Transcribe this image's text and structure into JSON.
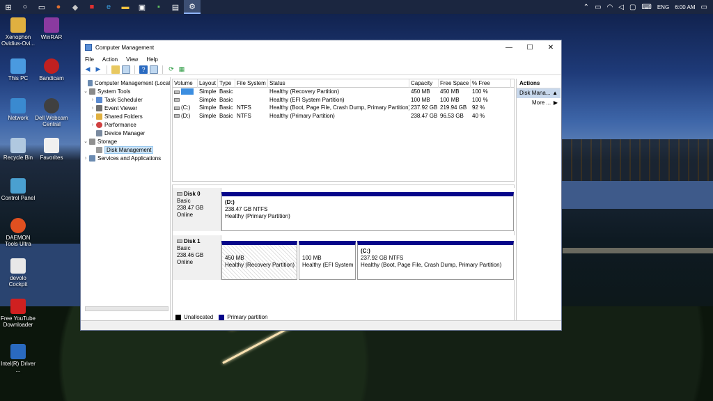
{
  "taskbar": {
    "language": "ENG",
    "time": "6:00 AM"
  },
  "desktop_icons": [
    {
      "label": "Xenophon Ovidius-Ovi..."
    },
    {
      "label": "WinRAR"
    },
    {
      "label": "This PC"
    },
    {
      "label": "Bandicam"
    },
    {
      "label": "Network"
    },
    {
      "label": "Dell Webcam Central"
    },
    {
      "label": "Recycle Bin"
    },
    {
      "label": "Favorites"
    },
    {
      "label": "Control Panel"
    },
    {
      "label": "DAEMON Tools Ultra"
    },
    {
      "label": "devolo Cockpit"
    },
    {
      "label": "Free YouTube Downloader"
    },
    {
      "label": "Intel(R) Driver ..."
    }
  ],
  "window": {
    "title": "Computer Management",
    "menu": [
      "File",
      "Action",
      "View",
      "Help"
    ]
  },
  "tree": {
    "root": "Computer Management (Local",
    "system_tools": "System Tools",
    "task_scheduler": "Task Scheduler",
    "event_viewer": "Event Viewer",
    "shared_folders": "Shared Folders",
    "performance": "Performance",
    "device_manager": "Device Manager",
    "storage": "Storage",
    "disk_management": "Disk Management",
    "services": "Services and Applications"
  },
  "volume_table": {
    "headers": [
      "Volume",
      "Layout",
      "Type",
      "File System",
      "Status",
      "Capacity",
      "Free Space",
      "% Free"
    ],
    "rows": [
      {
        "volume": "",
        "layout": "Simple",
        "type": "Basic",
        "fs": "",
        "status": "Healthy (Recovery Partition)",
        "capacity": "450 MB",
        "free": "450 MB",
        "pct": "100 %"
      },
      {
        "volume": "",
        "layout": "Simple",
        "type": "Basic",
        "fs": "",
        "status": "Healthy (EFI System Partition)",
        "capacity": "100 MB",
        "free": "100 MB",
        "pct": "100 %"
      },
      {
        "volume": "(C:)",
        "layout": "Simple",
        "type": "Basic",
        "fs": "NTFS",
        "status": "Healthy (Boot, Page File, Crash Dump, Primary Partition)",
        "capacity": "237.92 GB",
        "free": "219.94 GB",
        "pct": "92 %"
      },
      {
        "volume": "(D:)",
        "layout": "Simple",
        "type": "Basic",
        "fs": "NTFS",
        "status": "Healthy (Primary Partition)",
        "capacity": "238.47 GB",
        "free": "96.53 GB",
        "pct": "40 %"
      }
    ]
  },
  "disk0": {
    "name": "Disk 0",
    "type": "Basic",
    "size": "238.47 GB",
    "state": "Online",
    "p1_name": "(D:)",
    "p1_size": "238.47 GB NTFS",
    "p1_status": "Healthy (Primary Partition)"
  },
  "disk1": {
    "name": "Disk 1",
    "type": "Basic",
    "size": "238.46 GB",
    "state": "Online",
    "p1_size": "450 MB",
    "p1_status": "Healthy (Recovery Partition)",
    "p2_size": "100 MB",
    "p2_status": "Healthy (EFI System P",
    "p3_name": "(C:)",
    "p3_size": "237.92 GB NTFS",
    "p3_status": "Healthy (Boot, Page File, Crash Dump, Primary Partition)"
  },
  "legend": {
    "unallocated": "Unallocated",
    "primary": "Primary partition",
    "unallocated_color": "#000000",
    "primary_color": "#06068a"
  },
  "actions": {
    "header": "Actions",
    "sub": "Disk Mana...",
    "more": "More ..."
  }
}
